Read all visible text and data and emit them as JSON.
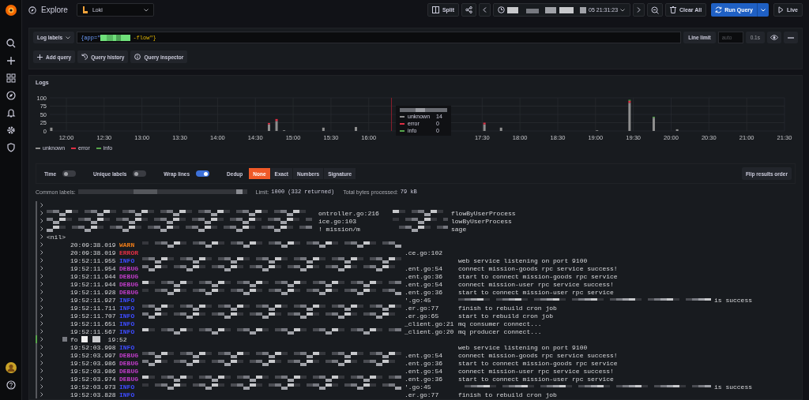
{
  "topbar": {
    "title": "Explore",
    "datasource": "Loki",
    "split": "Split",
    "time_range": "05 21:31:23",
    "clear": "Clear All",
    "run": "Run Query",
    "live": "Live"
  },
  "query": {
    "labels_button": "Log labels",
    "prefix": "{app=\"",
    "suffix": "-flow\"}",
    "line_limit": "Line limit",
    "limit_placeholder": "auto",
    "duration": "0.1s",
    "actions": [
      "Add query",
      "Query history",
      "Query inspector"
    ]
  },
  "logs": {
    "title": "Logs",
    "chart_data": {
      "type": "bar",
      "stacked": true,
      "grid": true,
      "legend": "bottom",
      "ref_lines": [
        {
          "axis": "x",
          "value": 16.3,
          "color": "#8a1f2c"
        }
      ],
      "x": [
        11.8,
        14.68,
        14.78,
        14.88,
        15.4,
        15.83,
        17.53,
        17.75,
        19.02,
        19.45,
        19.77,
        20.08
      ],
      "series": [
        {
          "name": "unknown",
          "color": "#8e8e8e",
          "values": [
            10,
            20,
            30,
            2,
            10,
            12,
            20,
            10,
            2,
            85,
            40,
            5
          ]
        },
        {
          "name": "error",
          "color": "#e02f44",
          "values": [
            0,
            4,
            6,
            0,
            0,
            0,
            5,
            0,
            0,
            6,
            0,
            0
          ]
        },
        {
          "name": "info",
          "color": "#56a64b",
          "values": [
            0,
            0,
            0,
            0,
            0,
            0,
            0,
            0,
            0,
            3,
            3,
            0
          ]
        }
      ],
      "xlim": [
        11.78,
        21.5
      ],
      "ylim": [
        0,
        100
      ],
      "yticks": [
        0,
        25,
        50,
        75,
        100
      ],
      "xticks": [
        {
          "value": 12,
          "label": "12:00"
        },
        {
          "value": 12.5,
          "label": "12:30"
        },
        {
          "value": 13,
          "label": "13:00"
        },
        {
          "value": 13.5,
          "label": "13:30"
        },
        {
          "value": 14,
          "label": "14:00"
        },
        {
          "value": 14.5,
          "label": "14:30"
        },
        {
          "value": 15,
          "label": "15:00"
        },
        {
          "value": 15.5,
          "label": "15:30"
        },
        {
          "value": 16,
          "label": "16:00"
        },
        {
          "value": 17.5,
          "label": "17:30"
        },
        {
          "value": 18,
          "label": "18:00"
        },
        {
          "value": 18.5,
          "label": "18:30"
        },
        {
          "value": 19,
          "label": "19:00"
        },
        {
          "value": 19.5,
          "label": "19:30"
        },
        {
          "value": 20,
          "label": "20:00"
        },
        {
          "value": 20.5,
          "label": "20:30"
        },
        {
          "value": 21,
          "label": "21:00"
        },
        {
          "value": 21.5,
          "label": "21:30"
        }
      ]
    },
    "tooltip": {
      "items": [
        {
          "label": "unknown",
          "value": "14",
          "color": "#8e8e8e"
        },
        {
          "label": "error",
          "value": "0",
          "color": "#e02f44"
        },
        {
          "label": "info",
          "value": "0",
          "color": "#56a64b"
        }
      ]
    },
    "toggles": [
      {
        "label": "Time",
        "on": false
      },
      {
        "label": "Unique labels",
        "on": false
      },
      {
        "label": "Wrap lines",
        "on": true
      }
    ],
    "dedup": {
      "label": "Dedup",
      "options": [
        {
          "label": "None",
          "selected": true
        },
        {
          "label": "Exact",
          "selected": false
        },
        {
          "label": "Numbers",
          "selected": false
        },
        {
          "label": "Signature",
          "selected": false
        }
      ]
    },
    "flip": "Flip results order",
    "meta": {
      "common_labels": "Common labels:",
      "limit_label": "Limit:",
      "limit_value": "1000 (332 returned)",
      "bytes_label": "Total bytes processed:",
      "bytes_value": "79 kB"
    },
    "rows": [
      {
        "kind": "raw",
        "redacted": false
      },
      {
        "kind": "raw",
        "redacted": true,
        "parts": [
          "ontroller.go:216",
          "flowByUserProcess"
        ]
      },
      {
        "kind": "raw",
        "redacted": true,
        "parts": [
          "ice.go:103",
          "lowByUserProcess"
        ]
      },
      {
        "kind": "raw",
        "redacted": true,
        "parts": [
          "! mission/m",
          "sage"
        ]
      },
      {
        "kind": "raw",
        "redacted": false,
        "parts": [
          "<nil>"
        ]
      },
      {
        "kind": "entry",
        "time": "20:09:38.019",
        "level": "WARN",
        "color": "#eb7b18",
        "redacted": true
      },
      {
        "kind": "entry",
        "time": "20:09:38.019",
        "level": "ERROR",
        "color": "#e02f44",
        "redacted": false,
        "source": ".ce.go:102"
      },
      {
        "kind": "entry",
        "time": "19:52:11.955",
        "level": "INFO",
        "color": "#3d4bff",
        "redacted": true,
        "message": "web service listening on port 9100"
      },
      {
        "kind": "entry",
        "time": "19:52:11.954",
        "level": "DEBUG",
        "color": "#c03dc9",
        "redacted": true,
        "source": ".ent.go:54",
        "message": "connect mission-goods rpc service success!"
      },
      {
        "kind": "entry",
        "time": "19:52:11.944",
        "level": "DEBUG",
        "color": "#c03dc9",
        "redacted": false,
        "source": ".ent.go:36",
        "message": "start to connect mission-goods rpc service"
      },
      {
        "kind": "entry",
        "time": "19:52:11.944",
        "level": "DEBUG",
        "color": "#c03dc9",
        "redacted": true,
        "source": ".ent.go:54",
        "message": "connect mission-user rpc service success!"
      },
      {
        "kind": "entry",
        "time": "19:52:11.928",
        "level": "DEBUG",
        "color": "#c03dc9",
        "redacted": true,
        "source": ".ent.go:36",
        "message": "start to connect mission-user rpc service"
      },
      {
        "kind": "entry",
        "time": "19:52:11.927",
        "level": "INFO",
        "color": "#3d4bff",
        "redacted": false,
        "source": "'.go:45",
        "message": "is success",
        "message_redacted": true
      },
      {
        "kind": "entry",
        "time": "19:52:11.711",
        "level": "INFO",
        "color": "#3d4bff",
        "redacted": true,
        "source": ".er.go:77",
        "message": "finish to rebuild cron job"
      },
      {
        "kind": "entry",
        "time": "19:52:11.707",
        "level": "INFO",
        "color": "#3d4bff",
        "redacted": true,
        "source": ".er.go:65",
        "message": "start to rebuild cron job"
      },
      {
        "kind": "entry",
        "time": "19:52:11.651",
        "level": "INFO",
        "color": "#3d4bff",
        "redacted": false,
        "source": "_client.go:21",
        "message": "mq consumer connect..."
      },
      {
        "kind": "entry",
        "time": "19:52:11.567",
        "level": "INFO",
        "color": "#3d4bff",
        "redacted": true,
        "source": "_client.go:20",
        "message": "mq producer connect..."
      },
      {
        "kind": "fragment",
        "redacted": true,
        "parts": [
          "fo",
          "19:52"
        ]
      },
      {
        "kind": "entry",
        "time": "19:52:03.998",
        "level": "INFO",
        "color": "#3d4bff",
        "redacted": false,
        "message": "web service listening on port 9100"
      },
      {
        "kind": "entry",
        "time": "19:52:03.997",
        "level": "DEBUG",
        "color": "#c03dc9",
        "redacted": true,
        "source": ".ent.go:54",
        "message": "connect mission-goods rpc service success!"
      },
      {
        "kind": "entry",
        "time": "19:52:03.986",
        "level": "DEBUG",
        "color": "#c03dc9",
        "redacted": true,
        "source": ".ent.go:36",
        "message": "start to connect mission-goods rpc service"
      },
      {
        "kind": "entry",
        "time": "19:52:03.986",
        "level": "DEBUG",
        "color": "#c03dc9",
        "redacted": false,
        "source": ".ent.go:54",
        "message": "connect mission-user rpc service success!"
      },
      {
        "kind": "entry",
        "time": "19:52:03.974",
        "level": "DEBUG",
        "color": "#c03dc9",
        "redacted": true,
        "source": ".ent.go:36",
        "message": "start to connect mission-user rpc service"
      },
      {
        "kind": "entry",
        "time": "19:52:03.973",
        "level": "INFO",
        "color": "#3d4bff",
        "redacted": true,
        "source": "'.go:45",
        "message": "is success",
        "message_redacted": true
      },
      {
        "kind": "entry",
        "time": "19:52:03.828",
        "level": "INFO",
        "color": "#3d4bff",
        "redacted": false,
        "source": ".er.go:77",
        "message": "finish to rebuild cron job"
      }
    ]
  }
}
